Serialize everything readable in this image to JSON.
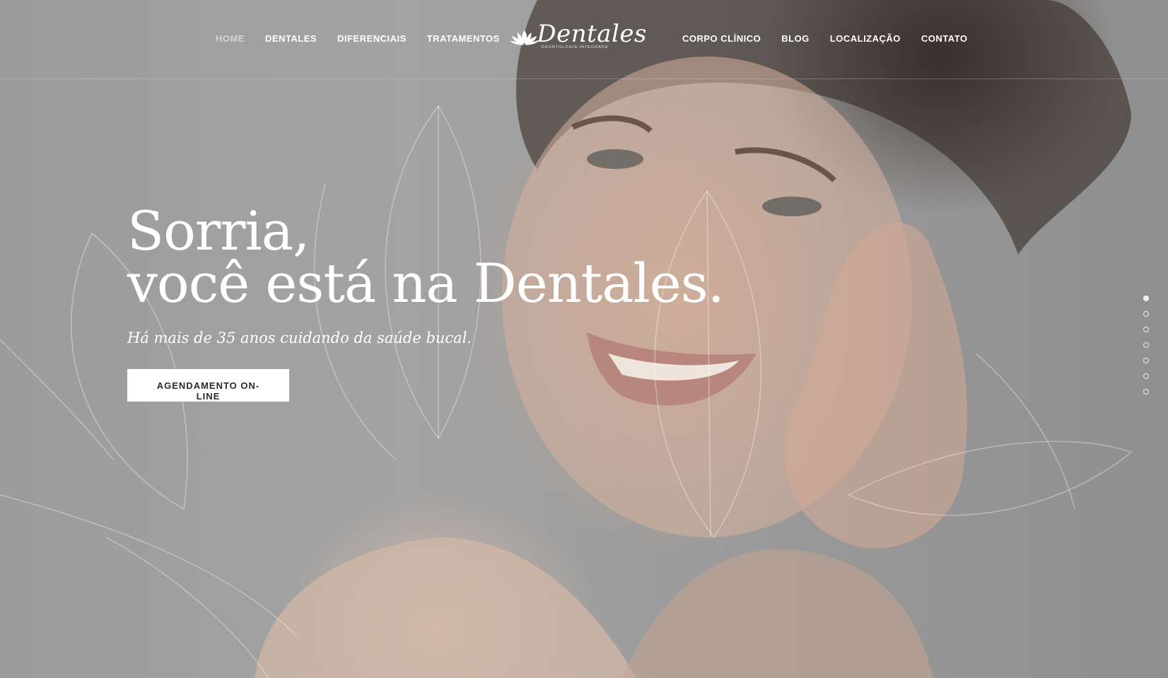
{
  "nav": {
    "left_items": [
      {
        "label": "HOME",
        "active": true
      },
      {
        "label": "DENTALES"
      },
      {
        "label": "DIFERENCIAIS"
      },
      {
        "label": "TRATAMENTOS"
      }
    ],
    "right_items": [
      {
        "label": "CORPO CLÍNICO"
      },
      {
        "label": "BLOG"
      },
      {
        "label": "LOCALIZAÇÃO"
      },
      {
        "label": "CONTATO"
      }
    ]
  },
  "brand": {
    "name": "Dentales",
    "tagline": "ODONTOLOGIA INTEGRADA",
    "icon": "lotus-logo-icon"
  },
  "hero": {
    "headline_line1": "Sorria,",
    "headline_line2": "você está na Dentales.",
    "subheadline": "Há mais de 35 anos cuidando da saúde bucal.",
    "cta_label": "AGENDAMENTO ON-LINE"
  },
  "slider": {
    "dot_count": 7,
    "active_index": 0
  },
  "colors": {
    "text": "#ffffff",
    "nav_active": "rgba(255,255,255,0.55)",
    "cta_background": "#ffffff",
    "cta_text": "#2b2b2b"
  }
}
